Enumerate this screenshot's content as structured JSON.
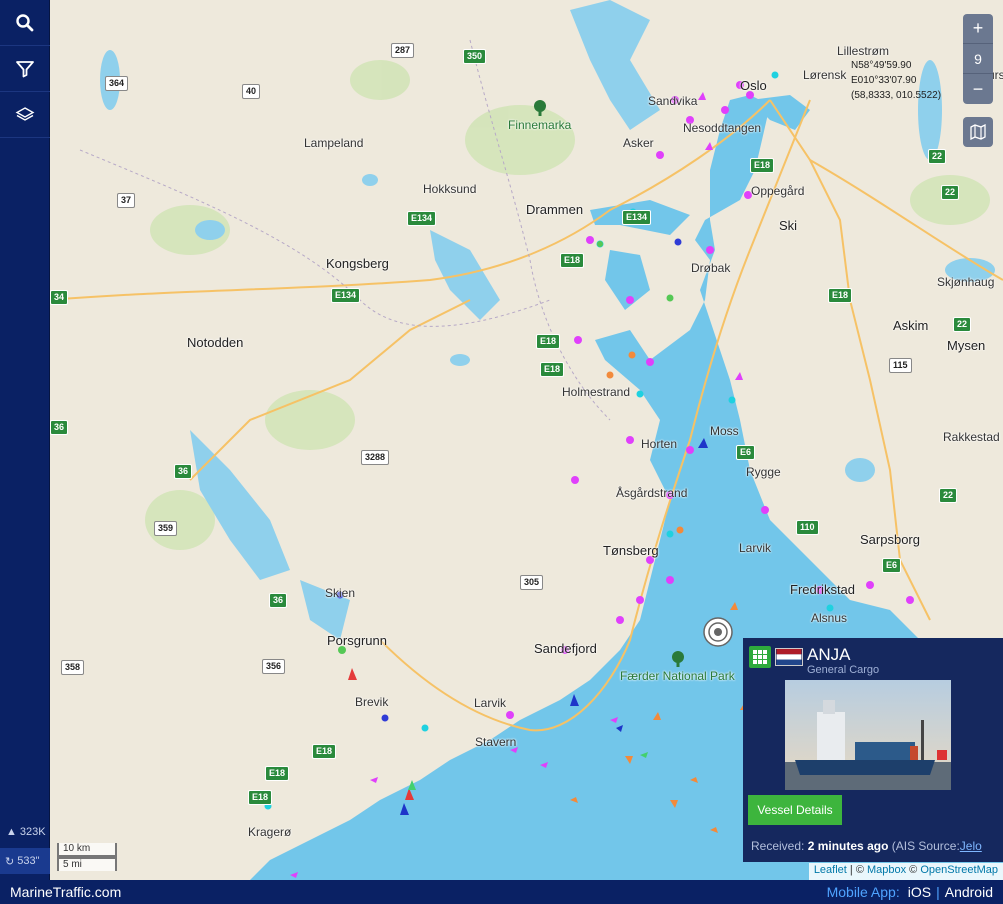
{
  "sidebar": {
    "ship_count": "323K",
    "refresh_count": "533\""
  },
  "map": {
    "zoom_level": "9",
    "coords": {
      "lat": "N58°49'59.90",
      "lon": "E010°33'07.90",
      "decimal": "(58,8333, 010.5522)"
    },
    "places": [
      {
        "key": "oslo",
        "label": "Oslo"
      },
      {
        "key": "lillestrom",
        "label": "Lillestrøm"
      },
      {
        "key": "lorenskog",
        "label": "Lørensk"
      },
      {
        "key": "aurs",
        "label": "Aurs"
      },
      {
        "key": "sandvika",
        "label": "Sandvika"
      },
      {
        "key": "nesoddtangen",
        "label": "Nesoddtangen"
      },
      {
        "key": "asker",
        "label": "Asker"
      },
      {
        "key": "oppegard",
        "label": "Oppegård"
      },
      {
        "key": "ski",
        "label": "Ski"
      },
      {
        "key": "finnemarka",
        "label": "Finnemarka"
      },
      {
        "key": "lampeland",
        "label": "Lampeland"
      },
      {
        "key": "hokksund",
        "label": "Hokksund"
      },
      {
        "key": "drammen",
        "label": "Drammen"
      },
      {
        "key": "drobak",
        "label": "Drøbak"
      },
      {
        "key": "kongsberg",
        "label": "Kongsberg"
      },
      {
        "key": "skjonhaug",
        "label": "Skjønhaug"
      },
      {
        "key": "askim",
        "label": "Askim"
      },
      {
        "key": "mysen",
        "label": "Mysen"
      },
      {
        "key": "notodden",
        "label": "Notodden"
      },
      {
        "key": "holmestrand",
        "label": "Holmestrand"
      },
      {
        "key": "moss",
        "label": "Moss"
      },
      {
        "key": "horten",
        "label": "Horten"
      },
      {
        "key": "rygge",
        "label": "Rygge"
      },
      {
        "key": "rakkestad",
        "label": "Rakkestad"
      },
      {
        "key": "asgardstrand",
        "label": "Åsgårdstrand"
      },
      {
        "key": "tonsberg",
        "label": "Tønsberg"
      },
      {
        "key": "larvik_e",
        "label": "Larvik"
      },
      {
        "key": "sarpsborg",
        "label": "Sarpsborg"
      },
      {
        "key": "fredrikstad",
        "label": "Fredrikstad"
      },
      {
        "key": "alsnus",
        "label": "Alsnus"
      },
      {
        "key": "skien",
        "label": "Skien"
      },
      {
        "key": "porsgrunn",
        "label": "Porsgrunn"
      },
      {
        "key": "sandefjord",
        "label": "Sandefjord"
      },
      {
        "key": "faerder",
        "label": "Færder National Park"
      },
      {
        "key": "brevik",
        "label": "Brevik"
      },
      {
        "key": "larvik",
        "label": "Larvik"
      },
      {
        "key": "stavern",
        "label": "Stavern"
      },
      {
        "key": "kragero",
        "label": "Kragerø"
      }
    ],
    "roads": [
      {
        "key": "r287",
        "label": "287",
        "style": "white"
      },
      {
        "key": "r350",
        "label": "350",
        "style": "green"
      },
      {
        "key": "r364",
        "label": "364",
        "style": "white"
      },
      {
        "key": "r40",
        "label": "40",
        "style": "white"
      },
      {
        "key": "r37",
        "label": "37",
        "style": "white"
      },
      {
        "key": "e134a",
        "label": "E134",
        "style": "green"
      },
      {
        "key": "e134b",
        "label": "E134",
        "style": "green"
      },
      {
        "key": "e134c",
        "label": "E134",
        "style": "green"
      },
      {
        "key": "e18a",
        "label": "E18",
        "style": "green"
      },
      {
        "key": "e18b",
        "label": "E18",
        "style": "green"
      },
      {
        "key": "e18c",
        "label": "E18",
        "style": "green"
      },
      {
        "key": "e18d",
        "label": "E18",
        "style": "green"
      },
      {
        "key": "e18e",
        "label": "E18",
        "style": "green"
      },
      {
        "key": "e18f",
        "label": "E18",
        "style": "green"
      },
      {
        "key": "e18g",
        "label": "E18",
        "style": "green"
      },
      {
        "key": "e18h",
        "label": "E18",
        "style": "green"
      },
      {
        "key": "e6a",
        "label": "E6",
        "style": "green"
      },
      {
        "key": "e6b",
        "label": "E6",
        "style": "green"
      },
      {
        "key": "r22a",
        "label": "22",
        "style": "green"
      },
      {
        "key": "r22b",
        "label": "22",
        "style": "green"
      },
      {
        "key": "r22c",
        "label": "22",
        "style": "green"
      },
      {
        "key": "r22d",
        "label": "22",
        "style": "green"
      },
      {
        "key": "r115",
        "label": "115",
        "style": "white"
      },
      {
        "key": "r110",
        "label": "110",
        "style": "green"
      },
      {
        "key": "r36a",
        "label": "36",
        "style": "green"
      },
      {
        "key": "r36b",
        "label": "36",
        "style": "green"
      },
      {
        "key": "r36c",
        "label": "36",
        "style": "green"
      },
      {
        "key": "r3288",
        "label": "3288",
        "style": "white"
      },
      {
        "key": "r359",
        "label": "359",
        "style": "white"
      },
      {
        "key": "r305",
        "label": "305",
        "style": "white"
      },
      {
        "key": "r358",
        "label": "358",
        "style": "white"
      },
      {
        "key": "r356",
        "label": "356",
        "style": "white"
      },
      {
        "key": "r34",
        "label": "34",
        "style": "green"
      }
    ],
    "scale": {
      "metric": "10 km",
      "imperial": "5 mi"
    },
    "attribution": {
      "leaflet": "Leaflet",
      "mapbox": "Mapbox",
      "osm": "OpenStreetMap"
    }
  },
  "popup": {
    "vessel_name": "ANJA",
    "vessel_type": "General Cargo",
    "details_label": "Vessel Details",
    "received_label": "Received:",
    "received_time": "2 minutes ago",
    "source_label": "(AIS Source:",
    "source_value": "Jelo"
  },
  "footer": {
    "brand": "MarineTraffic.com",
    "mobile_label": "Mobile App:",
    "ios": "iOS",
    "android": "Android"
  },
  "colors": {
    "sea": "#72c6ea",
    "land": "#eee9dc",
    "brand_navy": "#0a2164",
    "accent_green": "#3db53d"
  }
}
